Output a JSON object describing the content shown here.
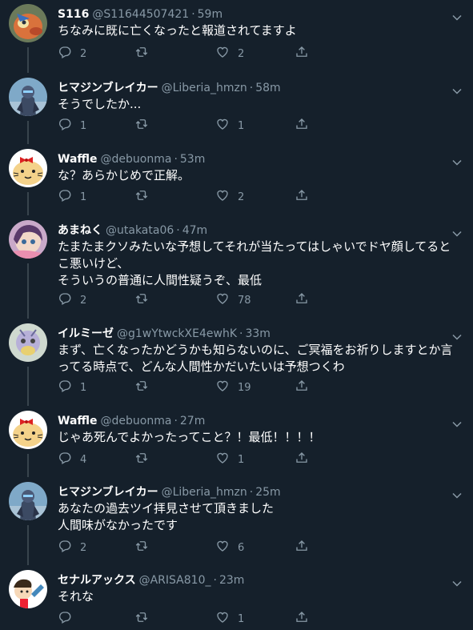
{
  "tweets": [
    {
      "name": "S116",
      "handle": "@S11644507421",
      "sep": "·",
      "time": "59m",
      "lines": [
        "ちなみに既に亡くなったと報道されてますよ"
      ],
      "replies": "2",
      "retweets": "",
      "likes": "2"
    },
    {
      "name": "ヒマジンブレイカー",
      "handle": "@Liberia_hmzn",
      "sep": "·",
      "time": "58m",
      "lines": [
        "そうでしたか..."
      ],
      "replies": "1",
      "retweets": "",
      "likes": "1"
    },
    {
      "name": "Waffle",
      "handle": "@debuonma",
      "sep": "·",
      "time": "53m",
      "lines": [
        "な？あらかじめで正解。"
      ],
      "replies": "1",
      "retweets": "",
      "likes": "2"
    },
    {
      "name": "あまねく",
      "handle": "@utakata06",
      "sep": "·",
      "time": "47m",
      "lines": [
        "たまたまクソみたいな予想してそれが当たってはしゃいでドヤ顔してると",
        "こ悪いけど、",
        "そういうの普通に人間性疑うぞ、最低"
      ],
      "replies": "2",
      "retweets": "",
      "likes": "78"
    },
    {
      "name": "イルミーゼ",
      "handle": "@g1wYtwckXE4ewhK",
      "sep": "·",
      "time": "33m",
      "lines": [
        "まず、亡くなったかどうかも知らないのに、ご冥福をお祈りしますとか言",
        "ってる時点で、どんな人間性かだいたいは予想つくわ"
      ],
      "replies": "1",
      "retweets": "",
      "likes": "19"
    },
    {
      "name": "Waffle",
      "handle": "@debuonma",
      "sep": "·",
      "time": "27m",
      "lines": [
        "じゃあ死んでよかったってこと？！最低！！！！"
      ],
      "replies": "4",
      "retweets": "",
      "likes": "1"
    },
    {
      "name": "ヒマジンブレイカー",
      "handle": "@Liberia_hmzn",
      "sep": "·",
      "time": "25m",
      "lines": [
        "あなたの過去ツイ拝見させて頂きました",
        "人間味がなかったです"
      ],
      "replies": "2",
      "retweets": "",
      "likes": "6"
    },
    {
      "name": "セナルアックス",
      "handle": "@ARISA810_",
      "sep": "·",
      "time": "23m",
      "lines": [
        "それな"
      ],
      "replies": "",
      "retweets": "",
      "likes": "1"
    }
  ],
  "icons": {
    "reply": "reply-icon",
    "retweet": "retweet-icon",
    "like": "heart-icon",
    "share": "share-icon",
    "more": "chevron-down-icon"
  },
  "colors": {
    "background": "#15202b",
    "secondary_text": "#8899a6",
    "thread_line": "#38444d"
  }
}
